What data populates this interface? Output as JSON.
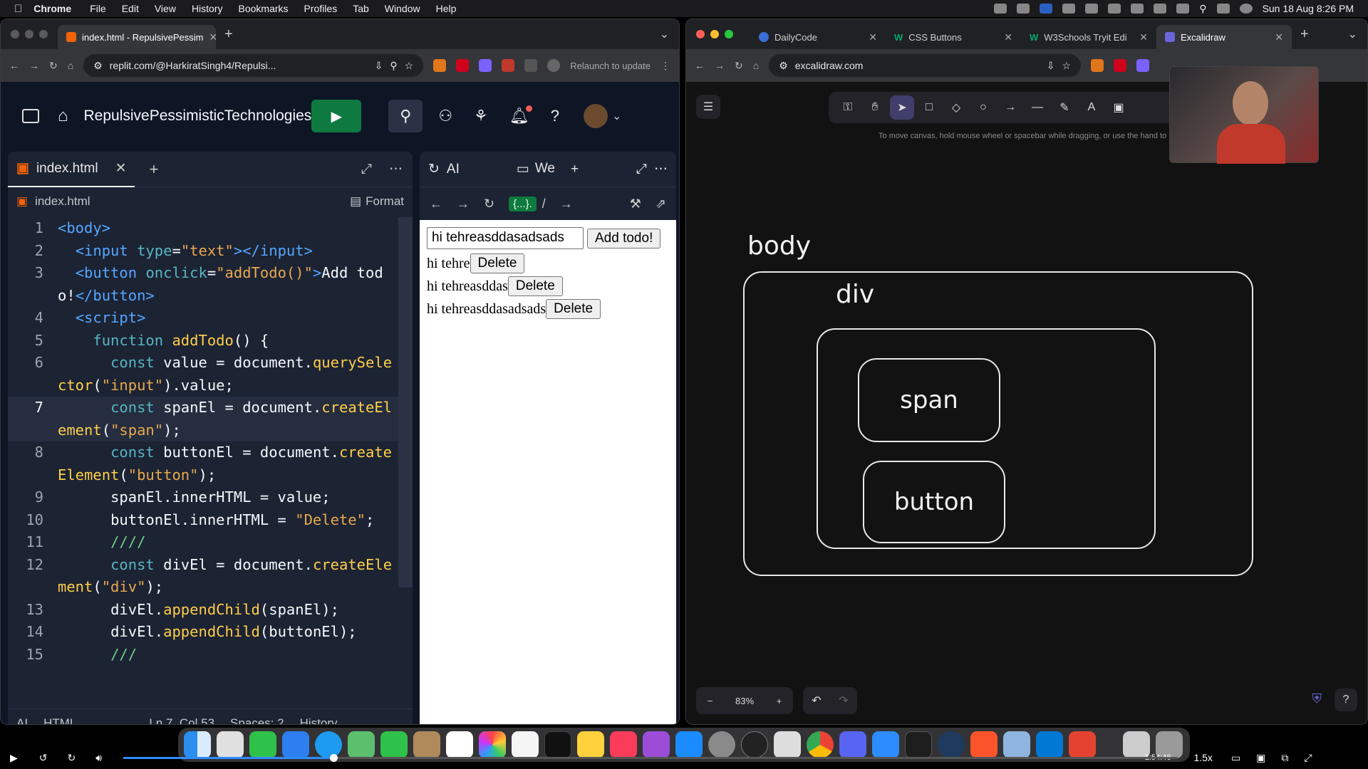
{
  "menubar": {
    "app": "Chrome",
    "items": [
      "File",
      "Edit",
      "View",
      "History",
      "Bookmarks",
      "Profiles",
      "Tab",
      "Window",
      "Help"
    ],
    "clock": "Sun 18 Aug  8:26 PM"
  },
  "left_window": {
    "tab": {
      "title": "index.html - RepulsivePessim"
    },
    "url": "replit.com/@HarkiratSingh4/Repulsi...",
    "relaunch": "Relaunch to update",
    "repl_name": "RepulsivePessimisticTechnologies",
    "editor": {
      "tab": "index.html",
      "breadcrumb": "index.html",
      "format": "Format",
      "lines": [
        {
          "n": "1",
          "parts": [
            [
              "t",
              "<body>"
            ]
          ]
        },
        {
          "n": "2",
          "parts": [
            [
              "p",
              "  "
            ],
            [
              "t",
              "<input "
            ],
            [
              "k",
              "type"
            ],
            [
              "p",
              "="
            ],
            [
              "s",
              "\"text\""
            ],
            [
              "t",
              "></input>"
            ]
          ]
        },
        {
          "n": "3",
          "parts": [
            [
              "p",
              "  "
            ],
            [
              "t",
              "<button "
            ],
            [
              "k",
              "onclick"
            ],
            [
              "p",
              "="
            ],
            [
              "s",
              "\"addTodo()\""
            ],
            [
              "t",
              ">"
            ],
            [
              "p",
              "Add todo!"
            ],
            [
              "t",
              "</button>"
            ]
          ]
        },
        {
          "n": "4",
          "parts": [
            [
              "p",
              "  "
            ],
            [
              "t",
              "<script>"
            ]
          ]
        },
        {
          "n": "5",
          "parts": [
            [
              "p",
              "    "
            ],
            [
              "k",
              "function "
            ],
            [
              "f",
              "addTodo"
            ],
            [
              "p",
              "() {"
            ]
          ]
        },
        {
          "n": "6",
          "parts": [
            [
              "p",
              "      "
            ],
            [
              "k",
              "const "
            ],
            [
              "p",
              "value = document."
            ],
            [
              "f",
              "querySelector"
            ],
            [
              "p",
              "("
            ],
            [
              "s",
              "\"input\""
            ],
            [
              "p",
              ").value;"
            ]
          ]
        },
        {
          "n": "7",
          "parts": [
            [
              "p",
              "      "
            ],
            [
              "k",
              "const "
            ],
            [
              "p",
              "spanEl = document."
            ],
            [
              "f",
              "createElement"
            ],
            [
              "p",
              "("
            ],
            [
              "s",
              "\"span\""
            ],
            [
              "p",
              ");"
            ]
          ]
        },
        {
          "n": "8",
          "parts": [
            [
              "p",
              "      "
            ],
            [
              "k",
              "const "
            ],
            [
              "p",
              "buttonEl = document."
            ],
            [
              "f",
              "createElement"
            ],
            [
              "p",
              "("
            ],
            [
              "s",
              "\"button\""
            ],
            [
              "p",
              ");"
            ]
          ]
        },
        {
          "n": "9",
          "parts": [
            [
              "p",
              "      spanEl.innerHTML = value;"
            ]
          ]
        },
        {
          "n": "10",
          "parts": [
            [
              "p",
              "      buttonEl.innerHTML = "
            ],
            [
              "s",
              "\"Delete\""
            ],
            [
              "p",
              ";"
            ]
          ]
        },
        {
          "n": "11",
          "parts": [
            [
              "p",
              "      "
            ],
            [
              "c",
              "////"
            ]
          ]
        },
        {
          "n": "12",
          "parts": [
            [
              "p",
              "      "
            ],
            [
              "k",
              "const "
            ],
            [
              "p",
              "divEl = document."
            ],
            [
              "f",
              "createElement"
            ],
            [
              "p",
              "("
            ],
            [
              "s",
              "\"div\""
            ],
            [
              "p",
              ");"
            ]
          ]
        },
        {
          "n": "13",
          "parts": [
            [
              "p",
              "      divEl."
            ],
            [
              "f",
              "appendChild"
            ],
            [
              "p",
              "(spanEl);"
            ]
          ]
        },
        {
          "n": "14",
          "parts": [
            [
              "p",
              "      divEl."
            ],
            [
              "f",
              "appendChild"
            ],
            [
              "p",
              "(buttonEl);"
            ]
          ]
        },
        {
          "n": "15",
          "parts": [
            [
              "p",
              "      "
            ],
            [
              "c",
              "///"
            ]
          ]
        }
      ],
      "status": {
        "ai": "AI",
        "lang": "HTML",
        "pos": "Ln 7, Col 53",
        "spaces": "Spaces: 2",
        "history": "History"
      }
    },
    "pane2": {
      "tab_ai": "AI",
      "tab_web": "We",
      "path": "/"
    },
    "webview": {
      "input_value": "hi tehreasddasadsads",
      "add_button": "Add todo!",
      "todos": [
        {
          "text": "hi tehre",
          "button": "Delete"
        },
        {
          "text": "hi tehreasddas",
          "button": "Delete"
        },
        {
          "text": "hi tehreasddasadsads",
          "button": "Delete"
        }
      ]
    }
  },
  "right_window": {
    "tabs": [
      {
        "title": "DailyCode"
      },
      {
        "title": "CSS Buttons"
      },
      {
        "title": "W3Schools Tryit Edi"
      },
      {
        "title": "Excalidraw"
      }
    ],
    "url": "excalidraw.com",
    "hint": "To move canvas, hold mouse wheel or spacebar while dragging, or use the hand to",
    "labels": {
      "body": "body",
      "div": "div",
      "span": "span",
      "button": "button"
    },
    "zoom": "83%"
  },
  "videobar": {
    "time": "-1:54:46",
    "speed": "1.5x"
  },
  "colors": {
    "run": "#0e7a3f",
    "replit_bg": "#0e1525",
    "editor_bg": "#1c2333",
    "canvas_bg": "#121212",
    "accent": "#1f8ae5"
  }
}
